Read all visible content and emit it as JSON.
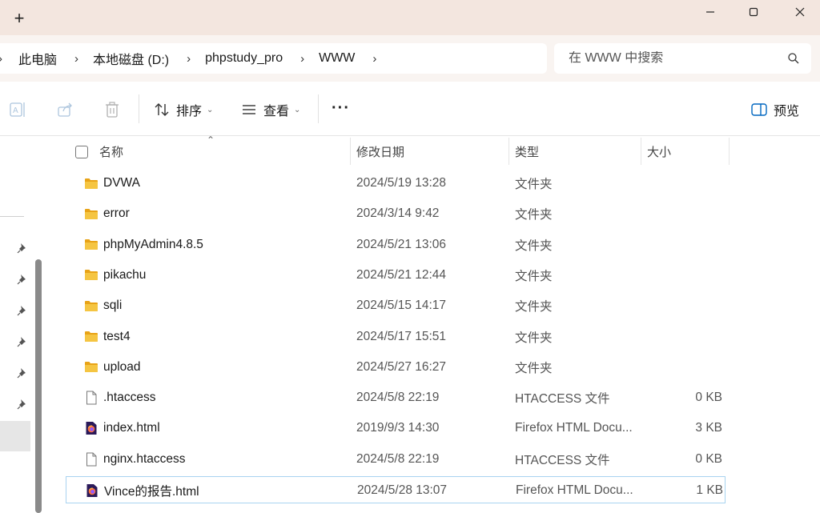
{
  "window": {
    "new_tab_symbol": "+",
    "minimize_symbol": "—",
    "maximize_symbol": "☐",
    "close_symbol": "✕"
  },
  "address": {
    "crumbs": [
      "此电脑",
      "本地磁盘 (D:)",
      "phpstudy_pro",
      "WWW"
    ],
    "separator": "›"
  },
  "search": {
    "placeholder": "在 WWW 中搜索"
  },
  "toolbar": {
    "sort_label": "排序",
    "view_label": "查看",
    "more_label": "···",
    "preview_label": "预览"
  },
  "columns": {
    "name": "名称",
    "date": "修改日期",
    "type": "类型",
    "size": "大小"
  },
  "files": [
    {
      "name": "DVWA",
      "date": "2024/5/19 13:28",
      "type": "文件夹",
      "size": "",
      "icon": "folder-icon"
    },
    {
      "name": "error",
      "date": "2024/3/14 9:42",
      "type": "文件夹",
      "size": "",
      "icon": "folder-icon"
    },
    {
      "name": "phpMyAdmin4.8.5",
      "date": "2024/5/21 13:06",
      "type": "文件夹",
      "size": "",
      "icon": "folder-icon"
    },
    {
      "name": "pikachu",
      "date": "2024/5/21 12:44",
      "type": "文件夹",
      "size": "",
      "icon": "folder-icon"
    },
    {
      "name": "sqli",
      "date": "2024/5/15 14:17",
      "type": "文件夹",
      "size": "",
      "icon": "folder-icon"
    },
    {
      "name": "test4",
      "date": "2024/5/17 15:51",
      "type": "文件夹",
      "size": "",
      "icon": "folder-icon"
    },
    {
      "name": "upload",
      "date": "2024/5/27 16:27",
      "type": "文件夹",
      "size": "",
      "icon": "folder-icon"
    },
    {
      "name": ".htaccess",
      "date": "2024/5/8 22:19",
      "type": "HTACCESS 文件",
      "size": "0 KB",
      "icon": "file-icon"
    },
    {
      "name": "index.html",
      "date": "2019/9/3 14:30",
      "type": "Firefox HTML Docu...",
      "size": "3 KB",
      "icon": "firefox-html-icon"
    },
    {
      "name": "nginx.htaccess",
      "date": "2024/5/8 22:19",
      "type": "HTACCESS 文件",
      "size": "0 KB",
      "icon": "file-icon"
    },
    {
      "name": "Vince的报告.html",
      "date": "2024/5/28 13:07",
      "type": "Firefox HTML Docu...",
      "size": "1 KB",
      "icon": "firefox-html-icon",
      "selected": true
    }
  ],
  "colors": {
    "titlebar": "#f3e6df",
    "folder": "#f5c542",
    "selection_border": "#a9d3f0",
    "accent": "#0067c0"
  }
}
